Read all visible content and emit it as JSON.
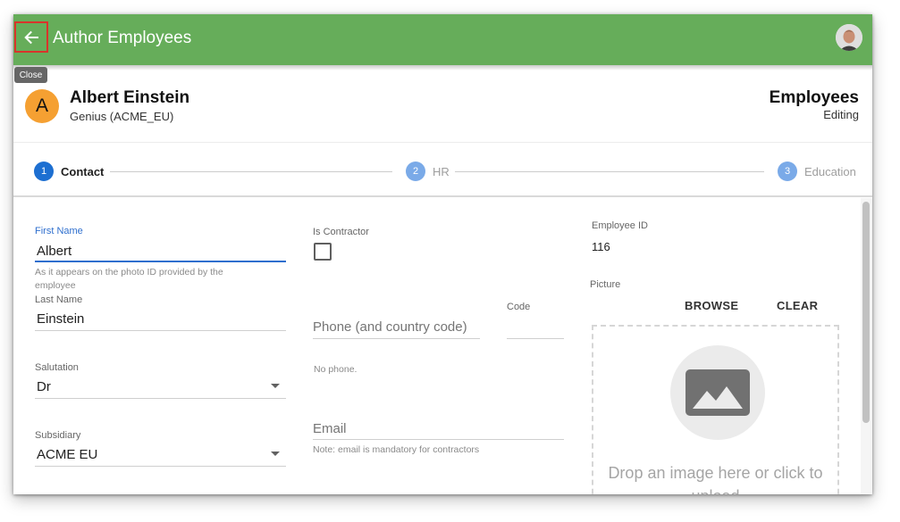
{
  "app_bar": {
    "title": "Author Employees",
    "back_tooltip": "Close",
    "color": "#66ad5a",
    "back_icon": "arrow-left-icon",
    "user_avatar": "user-photo"
  },
  "header": {
    "avatar_letter": "A",
    "avatar_color": "#f5a032",
    "name": "Albert Einstein",
    "subtitle": "Genius (ACME_EU)",
    "entity": "Employees",
    "mode": "Editing"
  },
  "stepper": {
    "steps": [
      {
        "number": "1",
        "label": "Contact",
        "active": true
      },
      {
        "number": "2",
        "label": "HR",
        "active": false
      },
      {
        "number": "3",
        "label": "Education",
        "active": false
      }
    ],
    "active_color": "#1d6fd1",
    "inactive_color": "#7aaae8"
  },
  "form": {
    "first_name": {
      "label": "First Name",
      "value": "Albert",
      "hint": "As it appears on the photo ID provided by the employee"
    },
    "last_name": {
      "label": "Last Name",
      "value": "Einstein"
    },
    "salutation": {
      "label": "Salutation",
      "value": "Dr"
    },
    "subsidiary": {
      "label": "Subsidiary",
      "value": "ACME EU"
    },
    "is_contractor": {
      "label": "Is Contractor",
      "checked": false
    },
    "phone": {
      "placeholder": "Phone (and country code)",
      "empty_text": "No phone."
    },
    "code": {
      "label": "Code",
      "value": ""
    },
    "email": {
      "placeholder": "Email",
      "hint": "Note: email is mandatory for contractors"
    },
    "employee_id": {
      "label": "Employee ID",
      "value": "116"
    },
    "picture": {
      "label": "Picture",
      "browse_label": "BROWSE",
      "clear_label": "CLEAR",
      "drop_text": "Drop an image here or click to upload"
    }
  }
}
